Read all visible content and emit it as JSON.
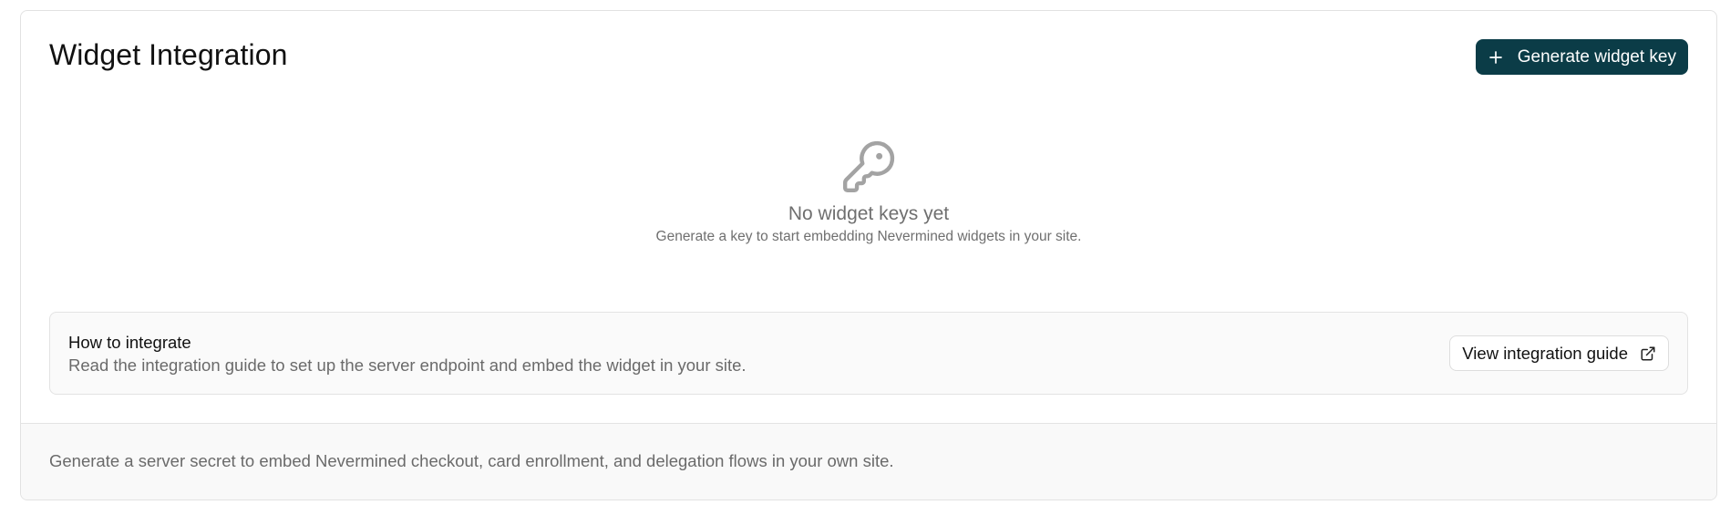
{
  "header": {
    "title": "Widget Integration",
    "generate_button_label": "Generate widget key"
  },
  "empty_state": {
    "icon": "key-icon",
    "title": "No widget keys yet",
    "subtitle": "Generate a key to start embedding Nevermined widgets in your site."
  },
  "guide": {
    "title": "How to integrate",
    "description": "Read the integration guide to set up the server endpoint and embed the widget in your site.",
    "button_label": "View integration guide",
    "button_icon": "external-link-icon"
  },
  "footer": {
    "text": "Generate a server secret to embed Nevermined checkout, card enrollment, and delegation flows in your own site."
  },
  "colors": {
    "primary": "#0b3c47",
    "muted_text": "#6f6f6f",
    "icon_gray": "#a3a3a3"
  }
}
